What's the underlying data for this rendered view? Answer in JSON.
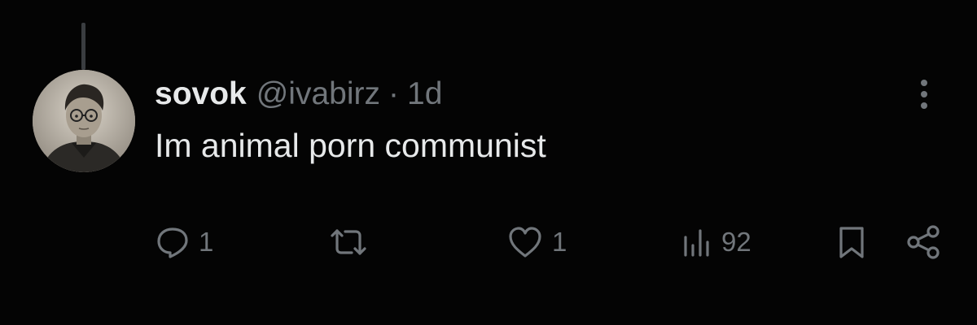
{
  "tweet": {
    "display_name": "sovok",
    "handle": "@ivabirz",
    "separator": "·",
    "time": "1d",
    "text": "Im animal porn communist"
  },
  "actions": {
    "reply": {
      "icon": "reply-icon",
      "count": "1"
    },
    "repost": {
      "icon": "repost-icon",
      "count": ""
    },
    "like": {
      "icon": "heart-icon",
      "count": "1"
    },
    "views": {
      "icon": "views-bar-chart-icon",
      "count": "92"
    },
    "bookmark": {
      "icon": "bookmark-icon"
    },
    "share": {
      "icon": "share-icon"
    }
  },
  "colors": {
    "background": "#040404",
    "primary_text": "#e7e9ea",
    "secondary_text": "#71767b",
    "thread_line": "#3a3d40"
  }
}
